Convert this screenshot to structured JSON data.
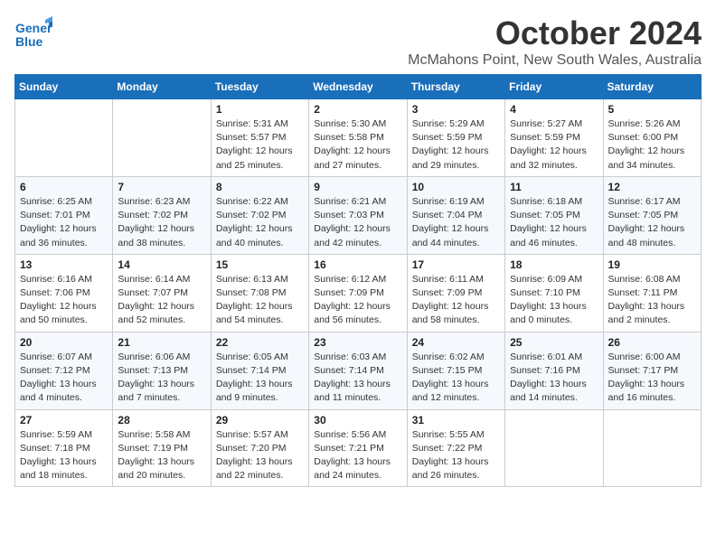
{
  "logo": {
    "line1": "General",
    "line2": "Blue"
  },
  "title": "October 2024",
  "location": "McMahons Point, New South Wales, Australia",
  "days_of_week": [
    "Sunday",
    "Monday",
    "Tuesday",
    "Wednesday",
    "Thursday",
    "Friday",
    "Saturday"
  ],
  "weeks": [
    [
      {
        "day": "",
        "info": ""
      },
      {
        "day": "",
        "info": ""
      },
      {
        "day": "1",
        "info": "Sunrise: 5:31 AM\nSunset: 5:57 PM\nDaylight: 12 hours\nand 25 minutes."
      },
      {
        "day": "2",
        "info": "Sunrise: 5:30 AM\nSunset: 5:58 PM\nDaylight: 12 hours\nand 27 minutes."
      },
      {
        "day": "3",
        "info": "Sunrise: 5:29 AM\nSunset: 5:59 PM\nDaylight: 12 hours\nand 29 minutes."
      },
      {
        "day": "4",
        "info": "Sunrise: 5:27 AM\nSunset: 5:59 PM\nDaylight: 12 hours\nand 32 minutes."
      },
      {
        "day": "5",
        "info": "Sunrise: 5:26 AM\nSunset: 6:00 PM\nDaylight: 12 hours\nand 34 minutes."
      }
    ],
    [
      {
        "day": "6",
        "info": "Sunrise: 6:25 AM\nSunset: 7:01 PM\nDaylight: 12 hours\nand 36 minutes."
      },
      {
        "day": "7",
        "info": "Sunrise: 6:23 AM\nSunset: 7:02 PM\nDaylight: 12 hours\nand 38 minutes."
      },
      {
        "day": "8",
        "info": "Sunrise: 6:22 AM\nSunset: 7:02 PM\nDaylight: 12 hours\nand 40 minutes."
      },
      {
        "day": "9",
        "info": "Sunrise: 6:21 AM\nSunset: 7:03 PM\nDaylight: 12 hours\nand 42 minutes."
      },
      {
        "day": "10",
        "info": "Sunrise: 6:19 AM\nSunset: 7:04 PM\nDaylight: 12 hours\nand 44 minutes."
      },
      {
        "day": "11",
        "info": "Sunrise: 6:18 AM\nSunset: 7:05 PM\nDaylight: 12 hours\nand 46 minutes."
      },
      {
        "day": "12",
        "info": "Sunrise: 6:17 AM\nSunset: 7:05 PM\nDaylight: 12 hours\nand 48 minutes."
      }
    ],
    [
      {
        "day": "13",
        "info": "Sunrise: 6:16 AM\nSunset: 7:06 PM\nDaylight: 12 hours\nand 50 minutes."
      },
      {
        "day": "14",
        "info": "Sunrise: 6:14 AM\nSunset: 7:07 PM\nDaylight: 12 hours\nand 52 minutes."
      },
      {
        "day": "15",
        "info": "Sunrise: 6:13 AM\nSunset: 7:08 PM\nDaylight: 12 hours\nand 54 minutes."
      },
      {
        "day": "16",
        "info": "Sunrise: 6:12 AM\nSunset: 7:09 PM\nDaylight: 12 hours\nand 56 minutes."
      },
      {
        "day": "17",
        "info": "Sunrise: 6:11 AM\nSunset: 7:09 PM\nDaylight: 12 hours\nand 58 minutes."
      },
      {
        "day": "18",
        "info": "Sunrise: 6:09 AM\nSunset: 7:10 PM\nDaylight: 13 hours\nand 0 minutes."
      },
      {
        "day": "19",
        "info": "Sunrise: 6:08 AM\nSunset: 7:11 PM\nDaylight: 13 hours\nand 2 minutes."
      }
    ],
    [
      {
        "day": "20",
        "info": "Sunrise: 6:07 AM\nSunset: 7:12 PM\nDaylight: 13 hours\nand 4 minutes."
      },
      {
        "day": "21",
        "info": "Sunrise: 6:06 AM\nSunset: 7:13 PM\nDaylight: 13 hours\nand 7 minutes."
      },
      {
        "day": "22",
        "info": "Sunrise: 6:05 AM\nSunset: 7:14 PM\nDaylight: 13 hours\nand 9 minutes."
      },
      {
        "day": "23",
        "info": "Sunrise: 6:03 AM\nSunset: 7:14 PM\nDaylight: 13 hours\nand 11 minutes."
      },
      {
        "day": "24",
        "info": "Sunrise: 6:02 AM\nSunset: 7:15 PM\nDaylight: 13 hours\nand 12 minutes."
      },
      {
        "day": "25",
        "info": "Sunrise: 6:01 AM\nSunset: 7:16 PM\nDaylight: 13 hours\nand 14 minutes."
      },
      {
        "day": "26",
        "info": "Sunrise: 6:00 AM\nSunset: 7:17 PM\nDaylight: 13 hours\nand 16 minutes."
      }
    ],
    [
      {
        "day": "27",
        "info": "Sunrise: 5:59 AM\nSunset: 7:18 PM\nDaylight: 13 hours\nand 18 minutes."
      },
      {
        "day": "28",
        "info": "Sunrise: 5:58 AM\nSunset: 7:19 PM\nDaylight: 13 hours\nand 20 minutes."
      },
      {
        "day": "29",
        "info": "Sunrise: 5:57 AM\nSunset: 7:20 PM\nDaylight: 13 hours\nand 22 minutes."
      },
      {
        "day": "30",
        "info": "Sunrise: 5:56 AM\nSunset: 7:21 PM\nDaylight: 13 hours\nand 24 minutes."
      },
      {
        "day": "31",
        "info": "Sunrise: 5:55 AM\nSunset: 7:22 PM\nDaylight: 13 hours\nand 26 minutes."
      },
      {
        "day": "",
        "info": ""
      },
      {
        "day": "",
        "info": ""
      }
    ]
  ]
}
